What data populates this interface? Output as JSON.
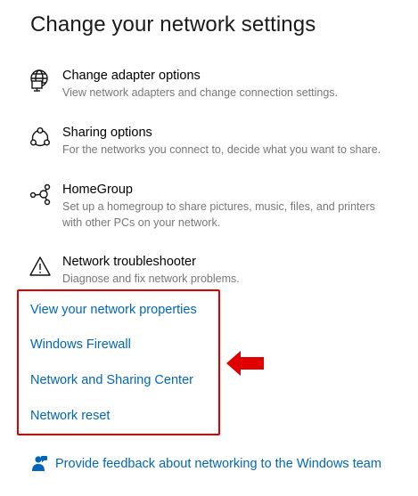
{
  "page": {
    "title": "Change your network settings"
  },
  "settings": [
    {
      "icon": "adapter-icon",
      "name": "Change adapter options",
      "desc": [
        "View network adapters and change connection settings."
      ]
    },
    {
      "icon": "sharing-icon",
      "name": "Sharing options",
      "desc": [
        "For the networks you connect to, decide what you want to share."
      ]
    },
    {
      "icon": "homegroup-icon",
      "name": "HomeGroup",
      "desc": [
        "Set up a homegroup to share pictures, music, files, and printers",
        "with other PCs on your network."
      ]
    },
    {
      "icon": "warning-icon",
      "name": "Network troubleshooter",
      "desc": [
        "Diagnose and fix network problems."
      ]
    }
  ],
  "links": [
    "View your network properties",
    "Windows Firewall",
    "Network and Sharing Center",
    "Network reset"
  ],
  "feedback": {
    "icon": "feedback-icon",
    "label": "Provide feedback about networking to the Windows team"
  },
  "colors": {
    "link": "#0067b8",
    "highlight_box": "#e00000",
    "arrow": "#e00000",
    "desc_text": "#767676"
  }
}
